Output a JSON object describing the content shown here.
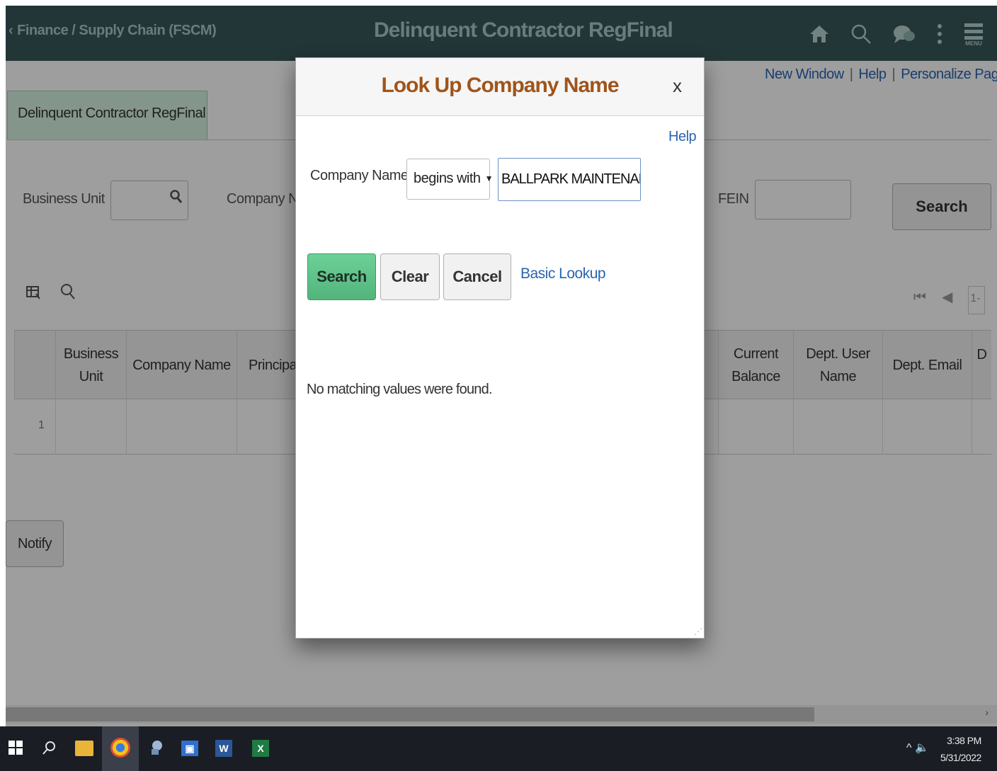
{
  "header": {
    "back_label": "Finance / Supply Chain (FSCM)",
    "title": "Delinquent Contractor RegFinal",
    "icons": [
      "home-icon",
      "search-icon",
      "chat-icon",
      "kebab-icon",
      "menu-icon"
    ],
    "menu_text": "MENU"
  },
  "top_links": {
    "new_window": "New Window",
    "help": "Help",
    "personalize": "Personalize Page"
  },
  "tab": {
    "label": "Delinquent Contractor RegFinal"
  },
  "search_form": {
    "business_unit_label": "Business Unit",
    "company_name_label": "Company Na",
    "fein_label": "FEIN",
    "search_button": "Search"
  },
  "grid": {
    "pager_range": "1-",
    "columns": [
      "Business Unit",
      "Company Name",
      "Principa",
      "Current Balance",
      "Dept. User Name",
      "Dept. Email",
      "D"
    ],
    "rows": [
      {
        "num": "1"
      }
    ]
  },
  "notify_button": "Notify",
  "modal": {
    "title": "Look Up Company Name",
    "close": "x",
    "help": "Help",
    "field_label": "Company Name",
    "operator": "begins with",
    "value": "BALLPARK MAINTENANC",
    "buttons": {
      "search": "Search",
      "clear": "Clear",
      "cancel": "Cancel"
    },
    "basic_lookup": "Basic Lookup",
    "message": "No matching values were found."
  },
  "taskbar": {
    "time": "3:38 PM",
    "date": "5/31/2022",
    "app_letters": {
      "word": "W",
      "excel": "X"
    }
  },
  "colors": {
    "header_bg": "#37565a",
    "modal_title": "#a0541a",
    "link": "#2a64b0",
    "primary_button": "#53b47c",
    "active_tab": "#d6f2e2"
  }
}
